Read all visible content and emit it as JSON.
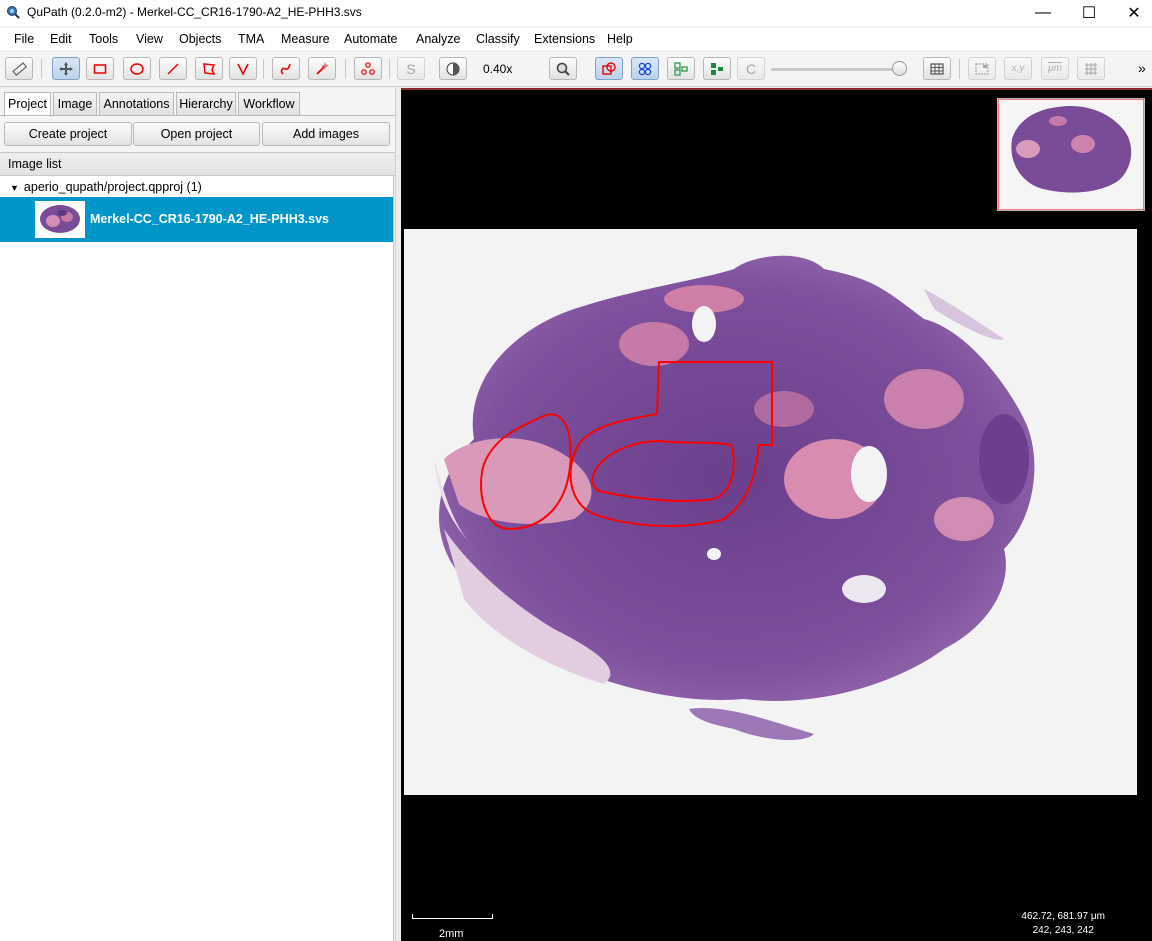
{
  "window": {
    "title": "QuPath (0.2.0-m2) - Merkel-CC_CR16-1790-A2_HE-PHH3.svs",
    "minimize": "—",
    "maximize": "☐",
    "close": "✕"
  },
  "menu": [
    "File",
    "Edit",
    "Tools",
    "View",
    "Objects",
    "TMA",
    "Measure",
    "Automate",
    "Analyze",
    "Classify",
    "Extensions",
    "Help"
  ],
  "toolbar": {
    "zoom": "0.40x",
    "brush_letter": "S",
    "detection_letter": "C",
    "coord_label": "x,y",
    "micron_label": "μm",
    "overflow": "»"
  },
  "tabs": [
    "Project",
    "Image",
    "Annotations",
    "Hierarchy",
    "Workflow"
  ],
  "project_buttons": {
    "create": "Create project",
    "open": "Open project",
    "add": "Add images"
  },
  "image_list": {
    "header": "Image list",
    "project": "aperio_qupath/project.qpproj (1)",
    "items": [
      {
        "name": "Merkel-CC_CR16-1790-A2_HE-PHH3.svs"
      }
    ]
  },
  "viewer": {
    "scale_label": "2mm",
    "cursor_position": "462.72, 681.97 μm",
    "cursor_rgb": "242, 243, 242"
  },
  "colors": {
    "selection": "#0096c9",
    "annotation": "#ff0000",
    "tissue_dark": "#6a3f8c",
    "tissue_pink": "#d98aae"
  }
}
